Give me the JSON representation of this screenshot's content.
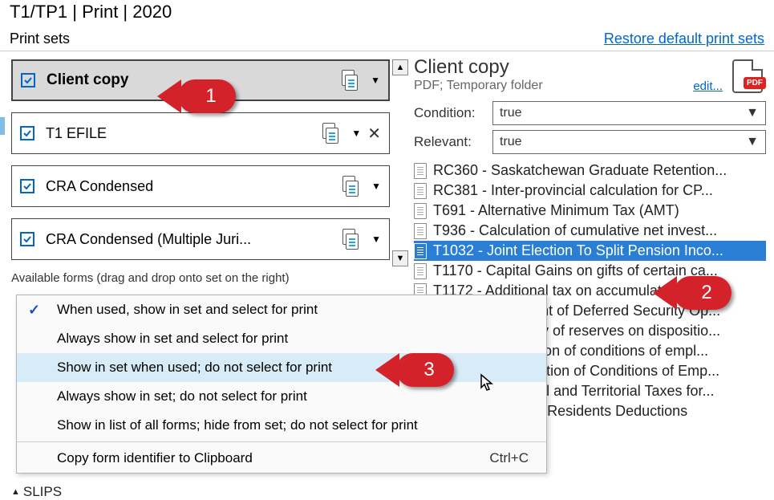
{
  "title": "T1/TP1 | Print | 2020",
  "subheader": {
    "label": "Print sets",
    "restore_link": "Restore default print sets"
  },
  "print_sets": [
    {
      "label": "Client copy",
      "selected": true,
      "has_close": false
    },
    {
      "label": "T1 EFILE",
      "selected": false,
      "has_close": true
    },
    {
      "label": "CRA Condensed",
      "selected": false,
      "has_close": false
    },
    {
      "label": "CRA Condensed (Multiple Juri...",
      "selected": false,
      "has_close": false
    }
  ],
  "available_label": "Available forms (drag and drop onto set on the right)",
  "slips_label": "SLIPS",
  "right_panel": {
    "title": "Client copy",
    "subtitle": "PDF; Temporary folder",
    "edit_link": "edit...",
    "condition_label": "Condition:",
    "condition_value": "true",
    "relevant_label": "Relevant:",
    "relevant_value": "true"
  },
  "forms": [
    {
      "text": "RC360 - Saskatchewan Graduate Retention...",
      "selected": false
    },
    {
      "text": "RC381 - Inter-provincial calculation for CP...",
      "selected": false
    },
    {
      "text": "T691 - Alternative Minimum Tax (AMT)",
      "selected": false
    },
    {
      "text": "T936 - Calculation of cumulative net invest...",
      "selected": false
    },
    {
      "text": "T1032 - Joint Election To Split Pension Inco...",
      "selected": true
    },
    {
      "text": "T1170 - Capital Gains on gifts of certain ca...",
      "selected": false
    },
    {
      "text": "T1172 - Additional tax on accumulated inc...",
      "selected": false
    },
    {
      "text": "T1212 - Statement of Deferred Security Op...",
      "selected": false
    },
    {
      "text": "T2017 - Summary of reserves on dispositio...",
      "selected": false
    },
    {
      "text": "T2200 - Declaration of conditions of empl...",
      "selected": false
    },
    {
      "text": "T2200S - Declaration of Conditions of Emp...",
      "selected": false
    },
    {
      "text": "T2203 - Provincial and Territorial Taxes for...",
      "selected": false
    },
    {
      "text": "T2222 - Northern Residents Deductions",
      "selected": false
    }
  ],
  "context_menu": {
    "items": [
      {
        "label": "When used, show in set and select for print",
        "checked": true
      },
      {
        "label": "Always show in set and select for print",
        "checked": false
      },
      {
        "label": "Show in set when used; do not select for print",
        "checked": false,
        "highlighted": true
      },
      {
        "label": "Always show in set; do not select for print",
        "checked": false
      },
      {
        "label": "Show in list of all forms; hide from set; do not select for print",
        "checked": false
      }
    ],
    "copy_label": "Copy form identifier to Clipboard",
    "copy_shortcut": "Ctrl+C"
  },
  "badges": {
    "b1": "1",
    "b2": "2",
    "b3": "3"
  }
}
